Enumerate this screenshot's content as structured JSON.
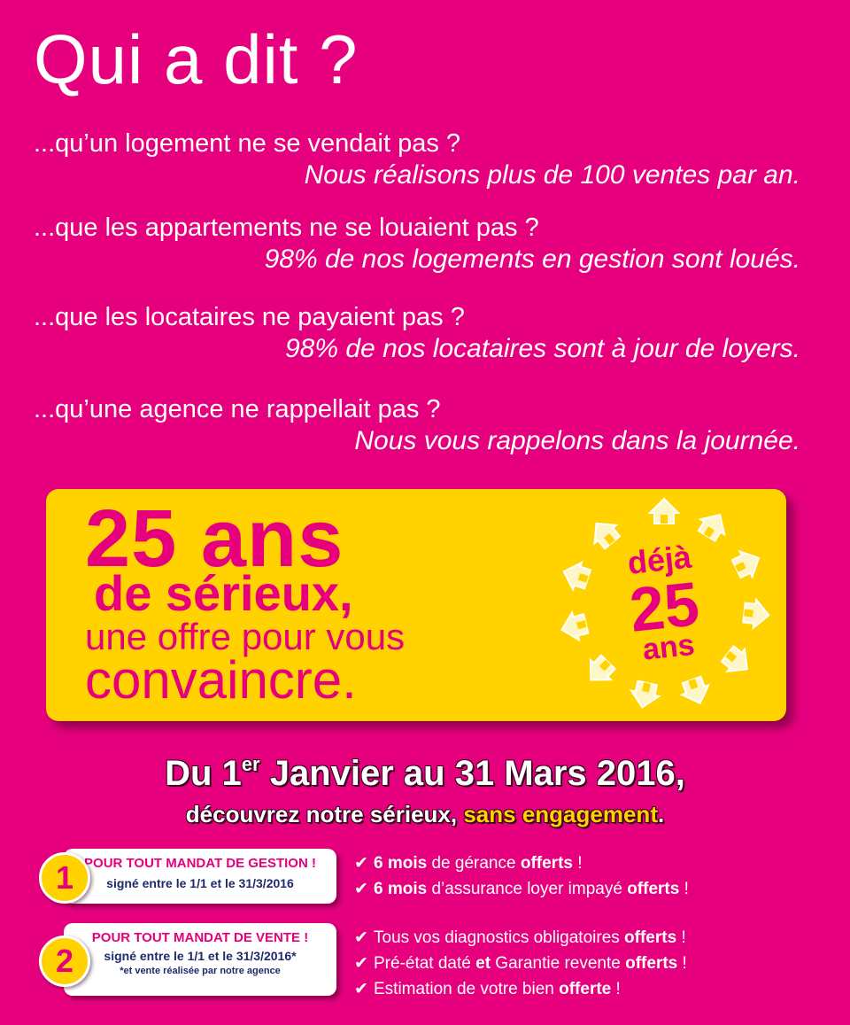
{
  "title": "Qui a dit ?",
  "qa": [
    {
      "q": "...qu’un logement ne se vendait pas ?",
      "a": "Nous réalisons plus de 100 ventes par an."
    },
    {
      "q": "...que les appartements ne se louaient pas ?",
      "a": "98% de nos logements en gestion sont loués."
    },
    {
      "q": "...que les locataires ne payaient pas ?",
      "a": "98% de nos locataires sont à jour de loyers."
    },
    {
      "q": "...qu’une agence ne rappellait pas ?",
      "a": "Nous vous rappelons dans la journée."
    }
  ],
  "promo": {
    "line1": "25 ans",
    "line2": "de sérieux,",
    "line3": "une offre pour vous",
    "line4": "convaincre.",
    "badge": {
      "top": "déjà",
      "number": "25",
      "bottom": "ans"
    }
  },
  "period": {
    "prefix": "Du 1",
    "sup": "er",
    "rest": " Janvier au 31 Mars 2016,"
  },
  "subline": {
    "before": "découvrez notre sérieux, ",
    "highlight": "sans engagement",
    "after": "."
  },
  "offers": [
    {
      "number": "1",
      "title": "POUR TOUT MANDAT DE GESTION !",
      "line": "signé entre le 1/1 et le 31/3/2016",
      "note": "",
      "benefits": [
        {
          "b1": "6 mois",
          "t1": " de gérance ",
          "b2": "offerts",
          "t2": " !"
        },
        {
          "b1": "6 mois",
          "t1": " d’assurance loyer impayé ",
          "b2": "offerts",
          "t2": " !"
        }
      ]
    },
    {
      "number": "2",
      "title": "POUR TOUT MANDAT DE VENTE !",
      "line": "signé entre le 1/1 et le 31/3/2016*",
      "note": "*et vente réalisée par notre agence",
      "benefits": [
        {
          "b1": "",
          "t1": "Tous vos diagnostics obligatoires ",
          "b2": "offerts",
          "t2": " !"
        },
        {
          "b1": "",
          "t1": "Pré-état daté ",
          "b2": "et",
          "t2": " Garantie revente "
        },
        {
          "b1": "",
          "t1": "Estimation de votre bien ",
          "b2": "offerte",
          "t2": " !"
        }
      ]
    }
  ],
  "offer2_line2_tail": {
    "b": "offerts",
    "t": " !"
  },
  "check_glyph": "✔",
  "colors": {
    "background": "#e6007e",
    "yellow": "#ffd200",
    "white": "#ffffff",
    "navy": "#1f2a6b"
  }
}
